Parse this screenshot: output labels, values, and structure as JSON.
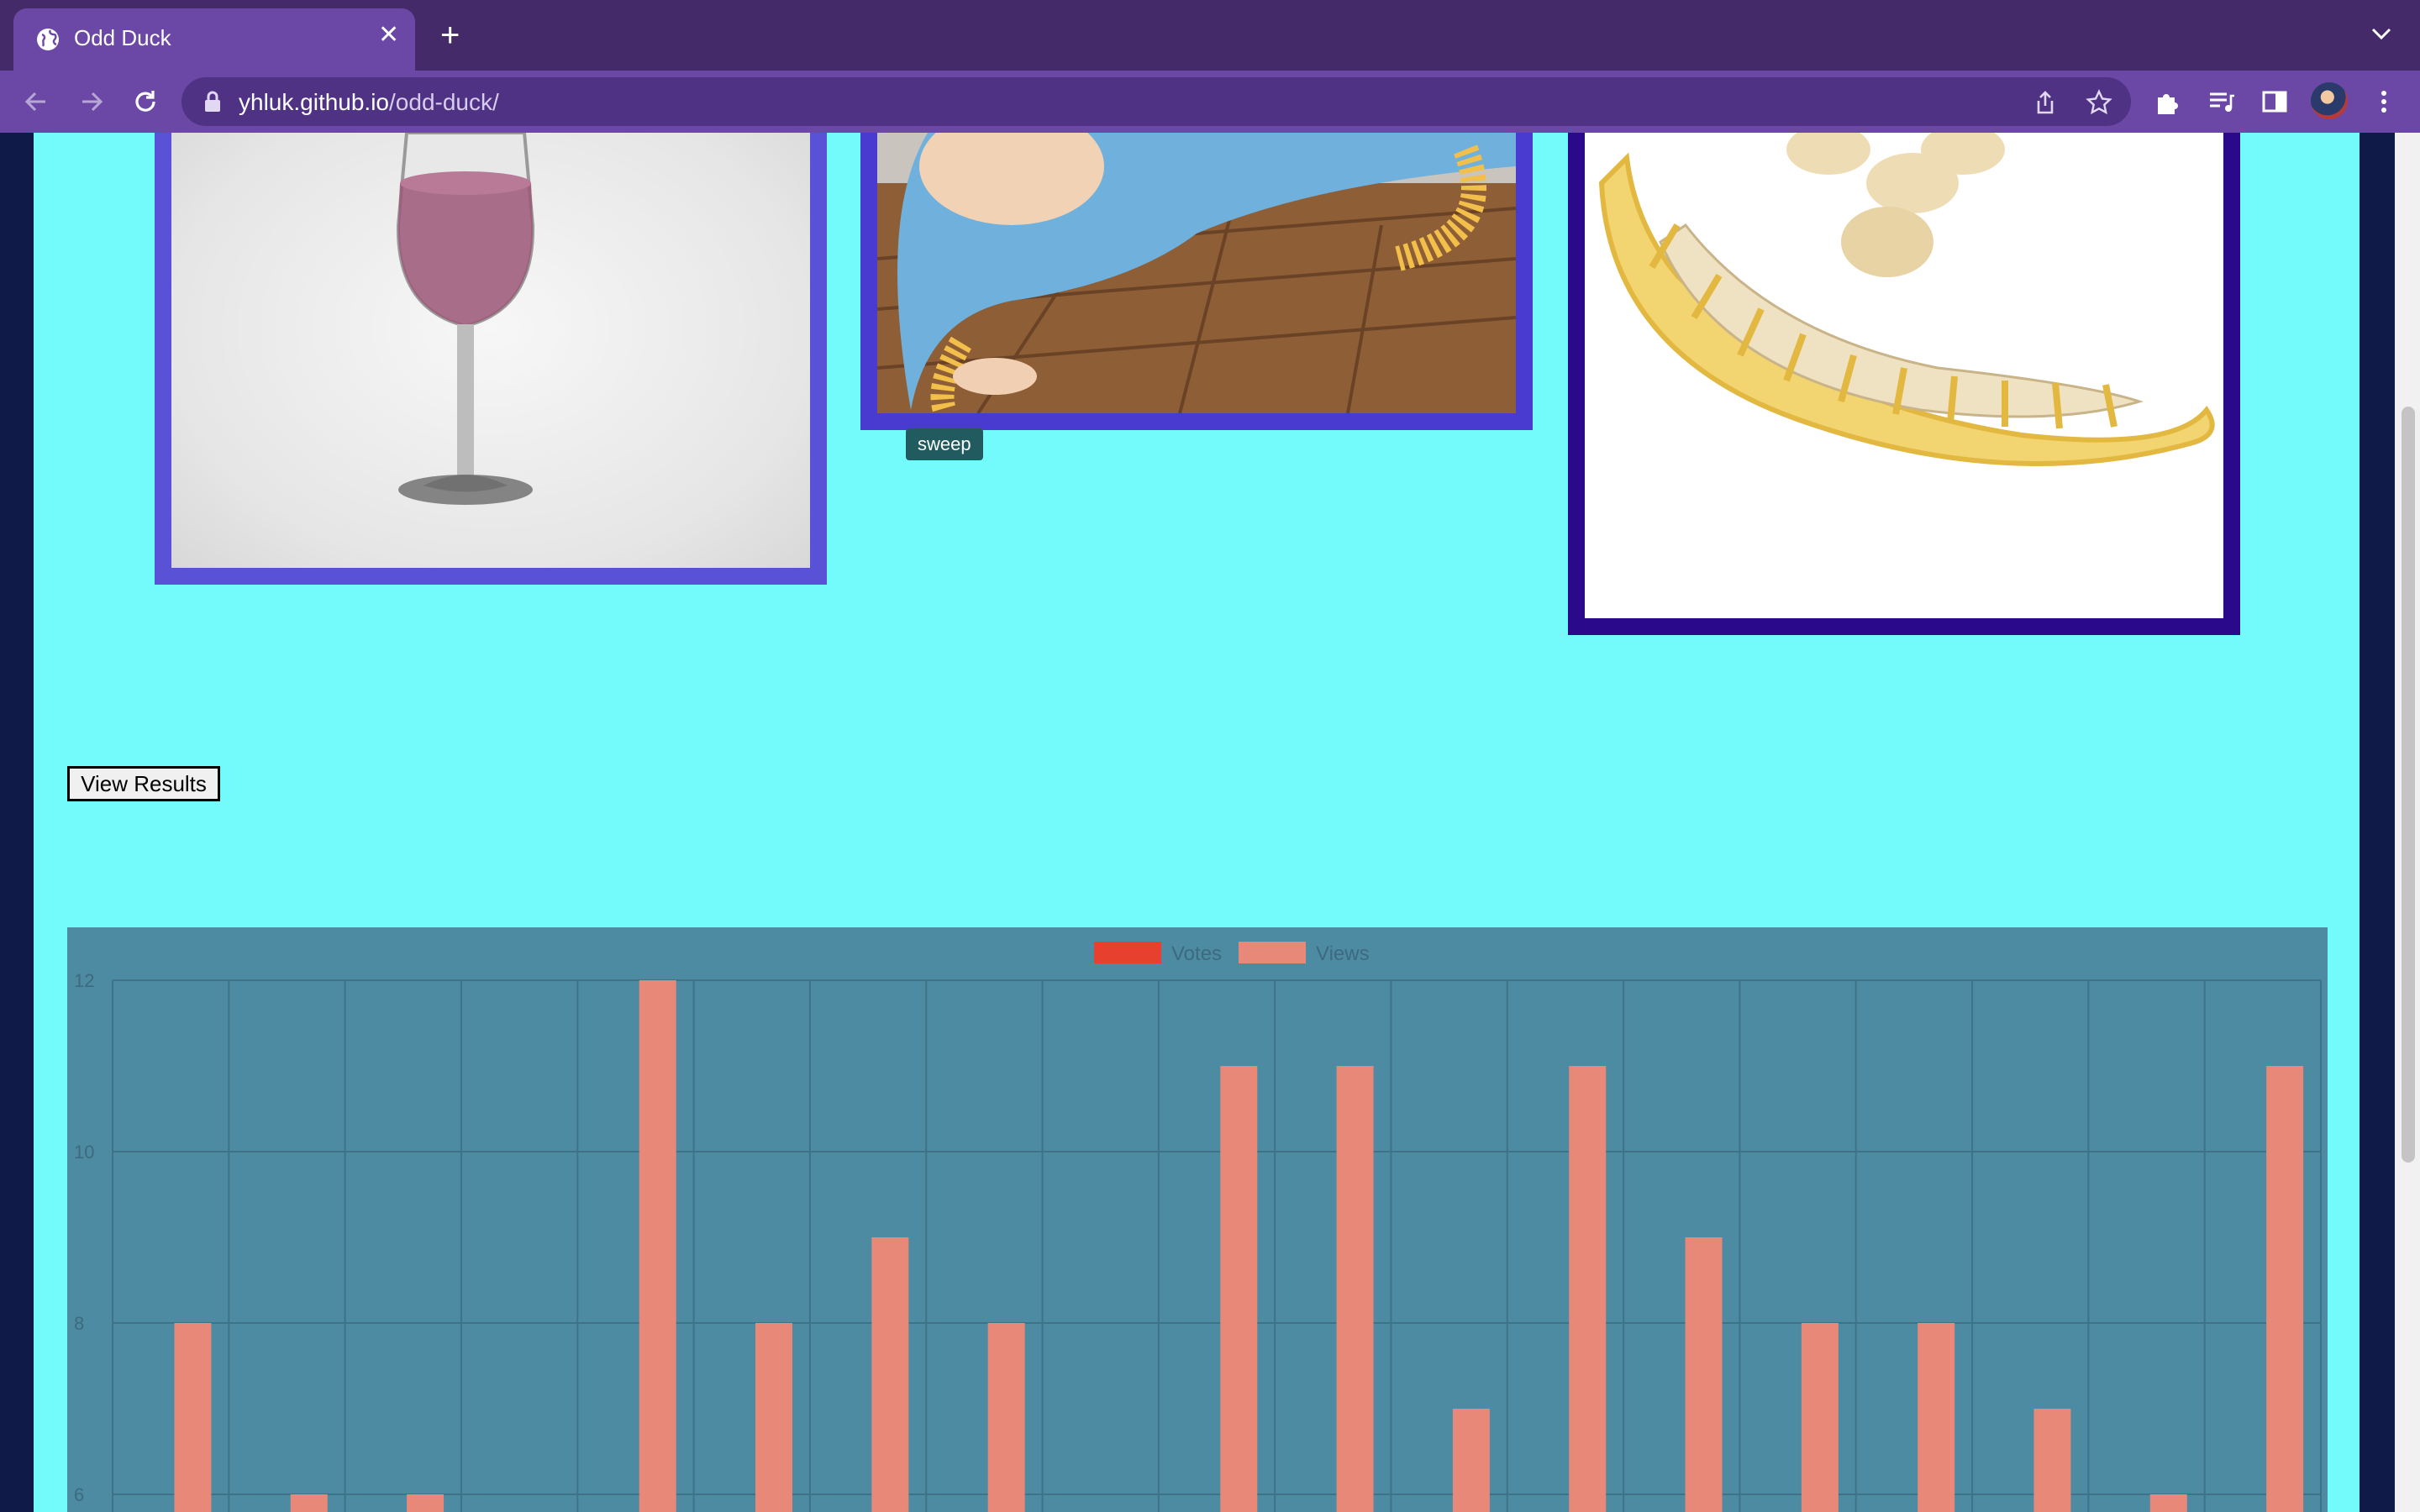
{
  "browser": {
    "tab_title": "Odd Duck",
    "url_host": "yhluk.github.io",
    "url_path": "/odd-duck/"
  },
  "products": [
    {
      "name": "wine-glass",
      "border_color": "#5a52d6"
    },
    {
      "name": "sweep",
      "border_color": "#4a3bd0",
      "tooltip": "sweep"
    },
    {
      "name": "banana",
      "border_color": "#2a0a8a"
    }
  ],
  "view_results_label": "View Results",
  "chart_data": {
    "type": "bar",
    "legend": [
      "Votes",
      "Views"
    ],
    "legend_position": "top",
    "grid": true,
    "colors": {
      "Votes": "#e8402e",
      "Views": "#e88878"
    },
    "ylim": [
      6,
      12
    ],
    "yticks": [
      "12",
      "10",
      "8",
      "6"
    ],
    "series": [
      {
        "name": "Votes",
        "values": []
      },
      {
        "name": "Views",
        "values": [
          8,
          6,
          6,
          null,
          12,
          8,
          9,
          8,
          null,
          11,
          11,
          7,
          11,
          9,
          8,
          8,
          7,
          6,
          11
        ]
      }
    ]
  },
  "colors": {
    "page_bg": "#73fbfc",
    "chart_bg": "#4c8ba1",
    "browser_tab": "#6b48a6"
  }
}
